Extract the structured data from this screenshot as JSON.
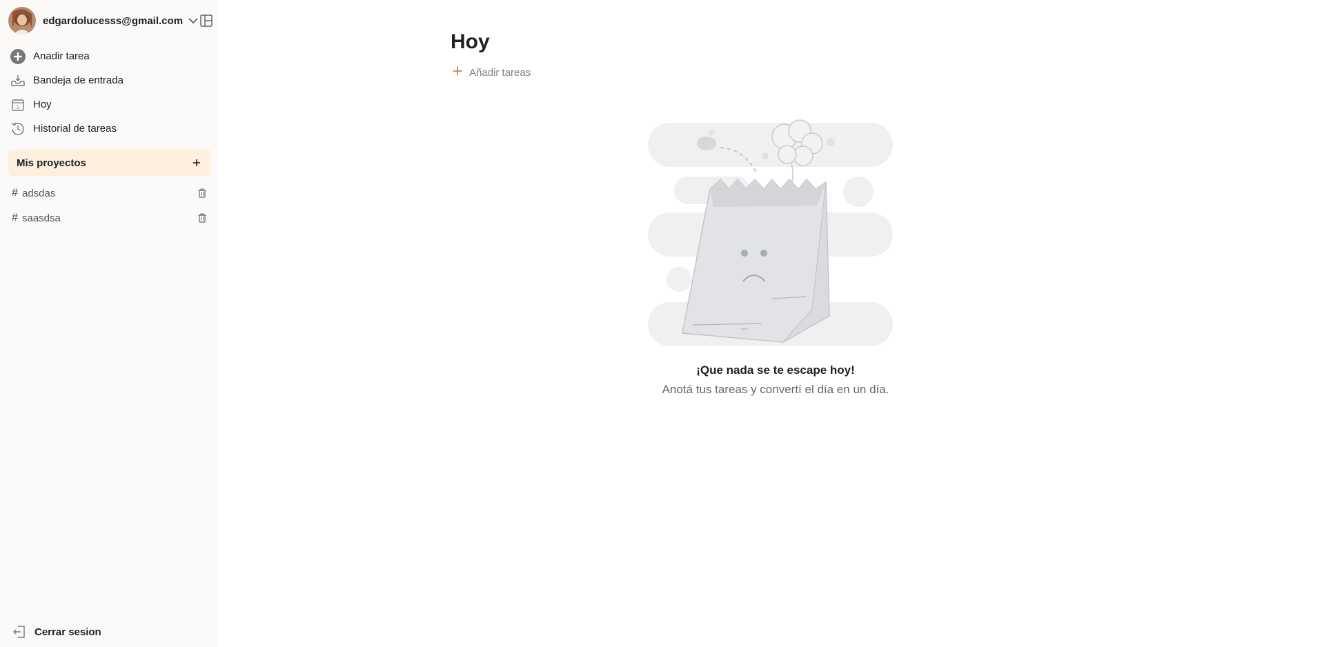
{
  "sidebar": {
    "account_email": "edgardolucesss@gmail.com",
    "nav": [
      {
        "label": "Anadir tarea",
        "icon": "add-circle-icon"
      },
      {
        "label": "Bandeja de entrada",
        "icon": "inbox-icon"
      },
      {
        "label": "Hoy",
        "icon": "calendar-today-icon"
      },
      {
        "label": "Historial de tareas",
        "icon": "history-icon"
      }
    ],
    "projects_title": "Mis proyectos",
    "projects": [
      {
        "hash": "#",
        "name": "adsdas"
      },
      {
        "hash": "#",
        "name": "saasdsa"
      }
    ],
    "logout_label": "Cerrar sesion"
  },
  "main": {
    "title": "Hoy",
    "add_tasks_label": "Añadir tareas",
    "empty_title": "¡Que nada se te escape hoy!",
    "empty_subtitle": "Anotá tus tareas y convertí el día en un día."
  },
  "colors": {
    "accent": "#dc4c3e",
    "add_orange": "#d1783a",
    "projects_header_bg": "#fdf0de",
    "sidebar_bg": "#fcfaf8"
  }
}
